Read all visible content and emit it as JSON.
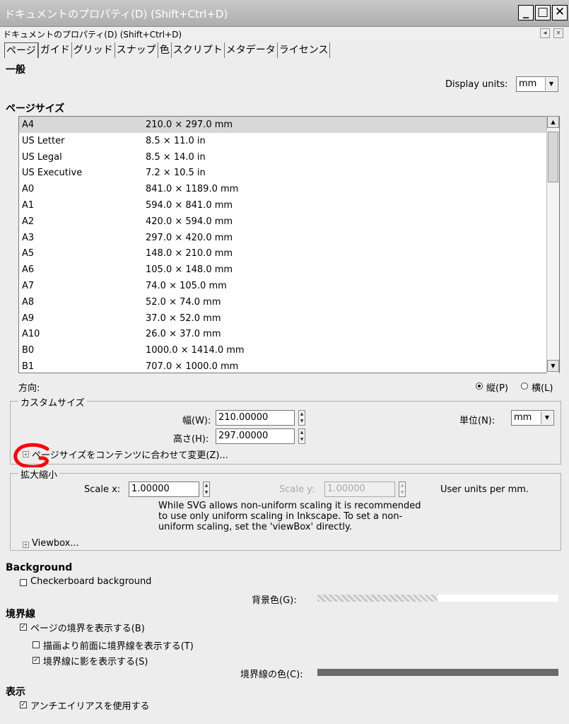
{
  "window": {
    "title": "ドキュメントのプロパティ(D) (Shift+Ctrl+D)",
    "subtitle": "ドキュメントのプロパティ(D) (Shift+Ctrl+D)"
  },
  "tabs": [
    "ページ",
    "ガイド",
    "グリッド",
    "スナップ",
    "色",
    "スクリプト",
    "メタデータ",
    "ライセンス"
  ],
  "general": {
    "heading": "一般",
    "display_units_label": "Display units:",
    "display_units_value": "mm"
  },
  "page_size": {
    "heading": "ページサイズ",
    "items": [
      {
        "name": "A4",
        "size": "210.0 × 297.0 mm"
      },
      {
        "name": "US Letter",
        "size": "8.5 × 11.0 in"
      },
      {
        "name": "US Legal",
        "size": "8.5 × 14.0 in"
      },
      {
        "name": "US Executive",
        "size": "7.2 × 10.5 in"
      },
      {
        "name": "A0",
        "size": "841.0 × 1189.0 mm"
      },
      {
        "name": "A1",
        "size": "594.0 × 841.0 mm"
      },
      {
        "name": "A2",
        "size": "420.0 × 594.0 mm"
      },
      {
        "name": "A3",
        "size": "297.0 × 420.0 mm"
      },
      {
        "name": "A5",
        "size": "148.0 × 210.0 mm"
      },
      {
        "name": "A6",
        "size": "105.0 × 148.0 mm"
      },
      {
        "name": "A7",
        "size": "74.0 × 105.0 mm"
      },
      {
        "name": "A8",
        "size": "52.0 × 74.0 mm"
      },
      {
        "name": "A9",
        "size": "37.0 × 52.0 mm"
      },
      {
        "name": "A10",
        "size": "26.0 × 37.0 mm"
      },
      {
        "name": "B0",
        "size": "1000.0 × 1414.0 mm"
      },
      {
        "name": "B1",
        "size": "707.0 × 1000.0 mm"
      }
    ]
  },
  "orientation": {
    "label": "方向:",
    "portrait": "縦(P)",
    "landscape": "横(L)"
  },
  "custom_size": {
    "legend": "カスタムサイズ",
    "width_label": "幅(W):",
    "width_value": "210.00000",
    "height_label": "高さ(H):",
    "height_value": "297.00000",
    "units_label": "単位(N):",
    "units_value": "mm",
    "resize_expander": "ページサイズをコンテンツに合わせて変更(Z)..."
  },
  "scale": {
    "legend": "拡大縮小",
    "scale_x_label": "Scale x:",
    "scale_x_value": "1.00000",
    "scale_y_label": "Scale y:",
    "scale_y_value": "1.00000",
    "user_units": "User units per mm.",
    "note": "While SVG allows non-uniform scaling it is recommended to use only uniform scaling in Inkscape. To set a non-uniform scaling, set the 'viewBox' directly.",
    "viewbox_expander": "Viewbox..."
  },
  "background": {
    "heading": "Background",
    "checkerboard_label": "Checkerboard background",
    "color_label": "背景色(G):"
  },
  "border": {
    "heading": "境界線",
    "show_border": "ページの境界を表示する(B)",
    "border_on_top": "描画より前面に境界線を表示する(T)",
    "show_shadow": "境界線に影を表示する(S)",
    "color_label": "境界線の色(C):"
  },
  "display": {
    "heading": "表示",
    "antialias": "アンチエイリアスを使用する"
  },
  "colors": {
    "annotation_red": "#ff0000",
    "border_color": "#6a6a6a"
  }
}
